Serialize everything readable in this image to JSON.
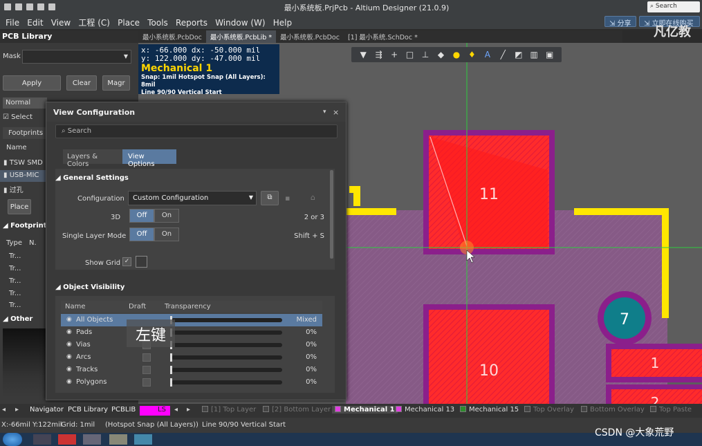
{
  "window": {
    "title": "最小系统板.PrjPcb - Altium Designer (21.0.9)",
    "search_placeholder": "Search",
    "share": "分享",
    "login": "立即在线购买",
    "watermark": "凡亿教"
  },
  "menu": [
    "File",
    "Edit",
    "View",
    "工程 (C)",
    "Place",
    "Tools",
    "Reports",
    "Window (W)",
    "Help"
  ],
  "doc_tabs": [
    {
      "label": "最小系统板.PcbDoc",
      "active": false
    },
    {
      "label": "最小系统板.PcbLib *",
      "active": true
    },
    {
      "label": "最小系统板.PcbDoc",
      "active": false
    },
    {
      "label": "[1] 最小系统.SchDoc *",
      "active": false
    }
  ],
  "left_panel": {
    "title": "PCB Library",
    "mask_label": "Mask",
    "apply": "Apply",
    "clear": "Clear",
    "magnify": "Magr",
    "mode": "Normal",
    "select": "Select",
    "footprints_tab": "Footprints",
    "name_header": "Name",
    "items": [
      "TSW SMD",
      "USB-MIC",
      "过孔"
    ],
    "place": "Place",
    "footprint_primitives": "Footprint P",
    "type_header": "Type",
    "n_header": "N.",
    "prim_rows": [
      "Tr...",
      "Tr...",
      "Tr...",
      "Tr...",
      "Tr..."
    ],
    "other": "Other"
  },
  "hud": {
    "line1": "x:  -66.000   dx:  -50.000 mil",
    "line2": "y:  122.000   dy:  -47.000 mil",
    "layer": "Mechanical 1",
    "snap": "Snap: 1mil Hotspot Snap (All Layers): 8mil",
    "mode": "Line 90/90 Vertical Start"
  },
  "canvas": {
    "pad_11": "11",
    "pad_10": "10",
    "pad_7": "7",
    "pad_1": "1",
    "pad_2": "2"
  },
  "view_config": {
    "title": "View Configuration",
    "search_placeholder": "Search",
    "tab_layers": "Layers & Colors",
    "tab_view": "View Options",
    "general_settings": "General Settings",
    "configuration_label": "Configuration",
    "configuration_value": "Custom Configuration",
    "label_3d": "3D",
    "off": "Off",
    "on": "On",
    "hint_3d": "2 or 3",
    "single_layer_label": "Single Layer Mode",
    "hint_single": "Shift + S",
    "show_grid_label": "Show Grid",
    "object_visibility": "Object Visibility",
    "col_name": "Name",
    "col_draft": "Draft",
    "col_transparency": "Transparency",
    "rows": [
      {
        "name": "All Objects",
        "value": "Mixed",
        "selected": true
      },
      {
        "name": "Pads",
        "value": "0%"
      },
      {
        "name": "Vias",
        "value": "0%"
      },
      {
        "name": "Arcs",
        "value": "0%"
      },
      {
        "name": "Tracks",
        "value": "0%"
      },
      {
        "name": "Polygons",
        "value": "0%"
      }
    ]
  },
  "overlay_key": "左键",
  "layer_tabs": [
    "Navigator",
    "PCB Library",
    "PCBLIB",
    "LS",
    "[1] Top Layer",
    "[2] Bottom Layer",
    "Mechanical 1",
    "Mechanical 13",
    "Mechanical 15",
    "Top Overlay",
    "Bottom Overlay",
    "Top Paste"
  ],
  "layer_colors": {
    "Mechanical 1": "#e040e0",
    "Mechanical 13": "#e040e0",
    "Mechanical 15": "#2e8b2e",
    "LS": "#ff00ff"
  },
  "status": {
    "coords": "X:-66mil Y:122mil",
    "grid": "Grid: 1mil",
    "snap": "(Hotspot Snap (All Layers))",
    "mode": "Line 90/90 Vertical Start"
  },
  "csdn": "CSDN @大象荒野"
}
